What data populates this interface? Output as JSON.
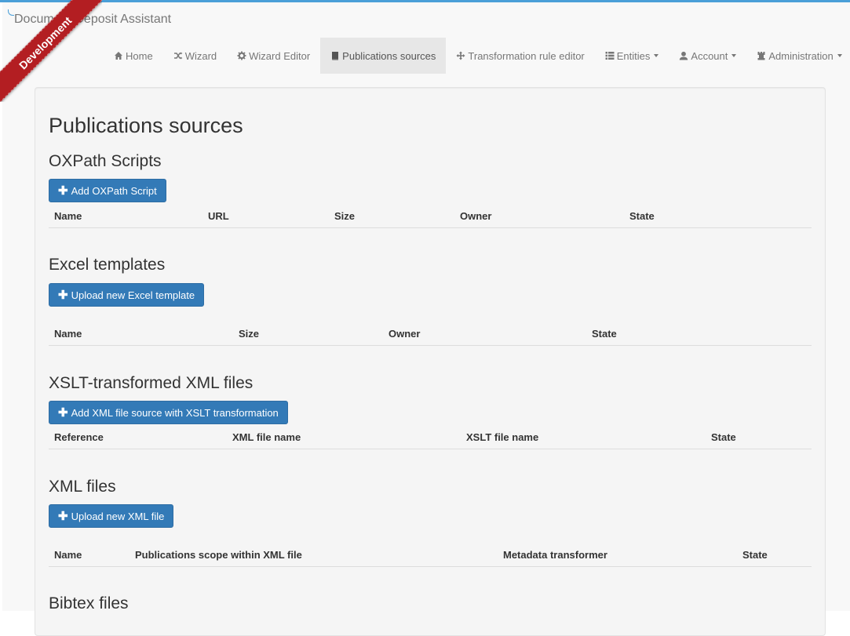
{
  "app": {
    "brand": "Document Deposit Assistant",
    "environment_ribbon": "Development",
    "accent_color": "#4a9fd8",
    "ribbon_color": "#b31e22"
  },
  "nav": {
    "items": [
      {
        "label": "Home",
        "icon": "home-icon"
      },
      {
        "label": "Wizard",
        "icon": "random-icon"
      },
      {
        "label": "Wizard Editor",
        "icon": "gear-icon"
      },
      {
        "label": "Publications sources",
        "icon": "book-icon",
        "active": true
      },
      {
        "label": "Transformation rule editor",
        "icon": "move-icon"
      },
      {
        "label": "Entities",
        "icon": "list-icon",
        "dropdown": true
      },
      {
        "label": "Account",
        "icon": "user-icon",
        "dropdown": true
      },
      {
        "label": "Administration",
        "icon": "tower-icon",
        "dropdown": true
      }
    ]
  },
  "page": {
    "title": "Publications sources"
  },
  "sections": {
    "oxpath": {
      "title": "OXPath Scripts",
      "button": "Add OXPath Script",
      "columns": [
        "Name",
        "URL",
        "Size",
        "Owner",
        "State"
      ]
    },
    "excel": {
      "title": "Excel templates",
      "button": "Upload new Excel template",
      "columns": [
        "Name",
        "Size",
        "Owner",
        "State"
      ]
    },
    "xslt": {
      "title": "XSLT-transformed XML files",
      "button": "Add XML file source with XSLT transformation",
      "columns": [
        "Reference",
        "XML file name",
        "XSLT file name",
        "State"
      ]
    },
    "xml": {
      "title": "XML files",
      "button": "Upload new XML file",
      "columns": [
        "Name",
        "Publications scope within XML file",
        "Metadata transformer",
        "State"
      ]
    },
    "bibtex": {
      "title": "Bibtex files"
    }
  },
  "colors": {
    "primary_button": "#337ab7",
    "well_background": "#f5f5f5"
  }
}
